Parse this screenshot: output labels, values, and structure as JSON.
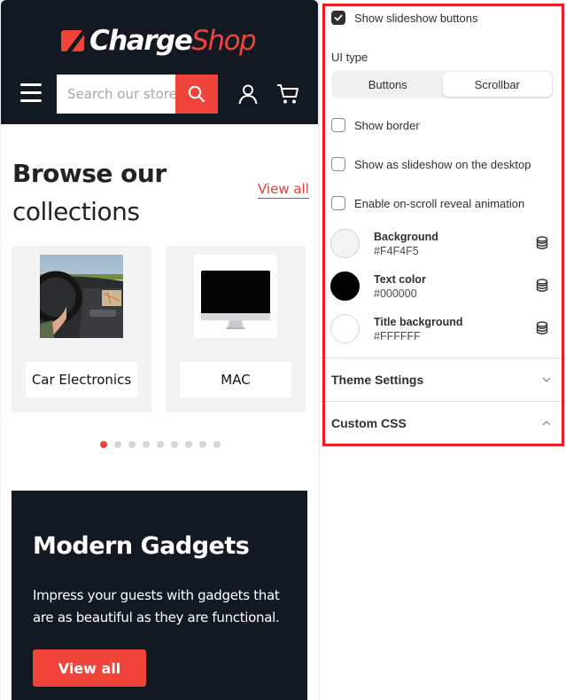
{
  "store": {
    "logo": {
      "part1": "Charge",
      "part2": "Shop"
    },
    "search": {
      "placeholder": "Search our store"
    },
    "icons": {
      "menu": "hamburger-icon",
      "search": "search-icon",
      "account": "user-icon",
      "cart": "cart-icon"
    },
    "collections": {
      "title_bold": "Browse our",
      "title_light": "collections",
      "view_all": "View all",
      "items": [
        {
          "label": "Car Electronics",
          "image": "car-dashboard-image"
        },
        {
          "label": "MAC",
          "image": "imac-image"
        }
      ],
      "pagination": {
        "total": 9,
        "active": 1
      }
    },
    "promo": {
      "title": "Modern Gadgets",
      "text": "Impress your guests with gadgets that are as beautiful as they are functional.",
      "button": "View all"
    }
  },
  "settings": {
    "show_slideshow_buttons": {
      "label": "Show slideshow buttons",
      "checked": true
    },
    "ui_type": {
      "label": "UI type",
      "options": [
        "Buttons",
        "Scrollbar"
      ],
      "selected": "Scrollbar"
    },
    "show_border": {
      "label": "Show border",
      "checked": false
    },
    "slideshow_desktop": {
      "label": "Show as slideshow on the desktop",
      "checked": false
    },
    "reveal_animation": {
      "label": "Enable on-scroll reveal animation",
      "checked": false
    },
    "colors": [
      {
        "name": "Background",
        "hex": "#F4F4F5"
      },
      {
        "name": "Text color",
        "hex": "#000000"
      },
      {
        "name": "Title background",
        "hex": "#FFFFFF"
      }
    ],
    "sections": [
      {
        "title": "Theme Settings",
        "expanded": false
      },
      {
        "title": "Custom CSS",
        "expanded": true
      }
    ]
  },
  "theme_colors": {
    "accent": "#F0443A",
    "header_bg": "#121923",
    "highlight": "#EE1C25"
  }
}
